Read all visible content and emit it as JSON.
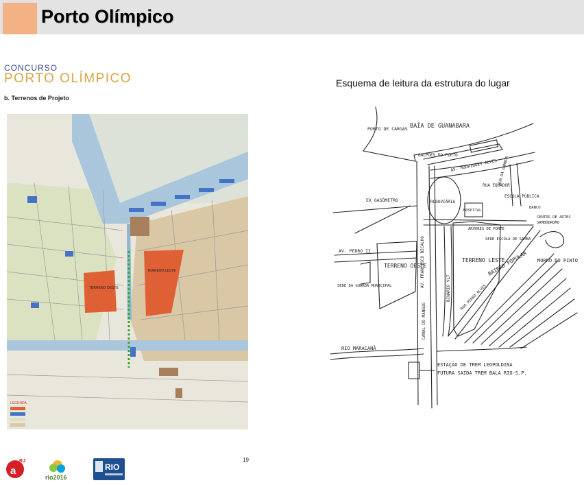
{
  "slide": {
    "title": "Porto Olímpico"
  },
  "left_document": {
    "concurso": "CONCURSO",
    "heading": "PORTO OLÍMPICO",
    "subheading": "b. Terrenos de Projeto",
    "map_labels": {
      "terreno_oeste": "TERRENO OESTE",
      "terreno_leste": "TERRENO LESTE"
    },
    "legend_title": "LEGENDA",
    "page_number": "19",
    "logos": {
      "rio2016": "rio2016",
      "rio": "RIO"
    }
  },
  "sketch": {
    "caption": "Esquema de leitura da estrutura do lugar",
    "labels": {
      "baia": "BAÍA DE GUANABARA",
      "porto_cargas": "PORTO DE CARGAS",
      "galpoes": "GALPÕES DO PORTO",
      "rodrigues_alves": "AV. RODRIGUES ALVES",
      "rua_equador": "RUA EQUADOR",
      "gamboa": "RUA DA GAMBOA",
      "gasometro": "EX GASÔMETRO",
      "rodoviaria": "RODOVIÁRIA",
      "hospital": "HOSPITAL",
      "escola_publica": "ESCOLA PÚBLICA",
      "banco": "BANCO",
      "centro_artes": "CENTRO DE ARTES",
      "sambodromo": "SAMBÓDROMO",
      "arvores": "ÁRVORES DE PORTE",
      "sede_escola": "SEDE ESCOLA DE SAMBA",
      "pedro_ii": "AV. PEDRO II",
      "terreno_oeste": "TERRENO OESTE",
      "terreno_leste": "TERRENO LESTE",
      "francisco_bicalho": "AV. FRANCISCO BICALHO",
      "binario": "BINÁRIO VLT",
      "bairro_popular": "BAIRRO POPULAR",
      "morro": "MORRO DO PINTO",
      "sede_guarda": "SEDE DA GUARDA MUNICIPAL",
      "rua_pedro_alves": "RUA PEDRO ALVES",
      "canal": "CANAL DO MANGUE",
      "rio_maracana": "RIO MARACANÃ",
      "estacao_line1": "ESTAÇÃO DE TREM LEOPOLDINA",
      "estacao_line2": "FUTURA SAÍDA TREM BALA RIO-S.P."
    }
  }
}
